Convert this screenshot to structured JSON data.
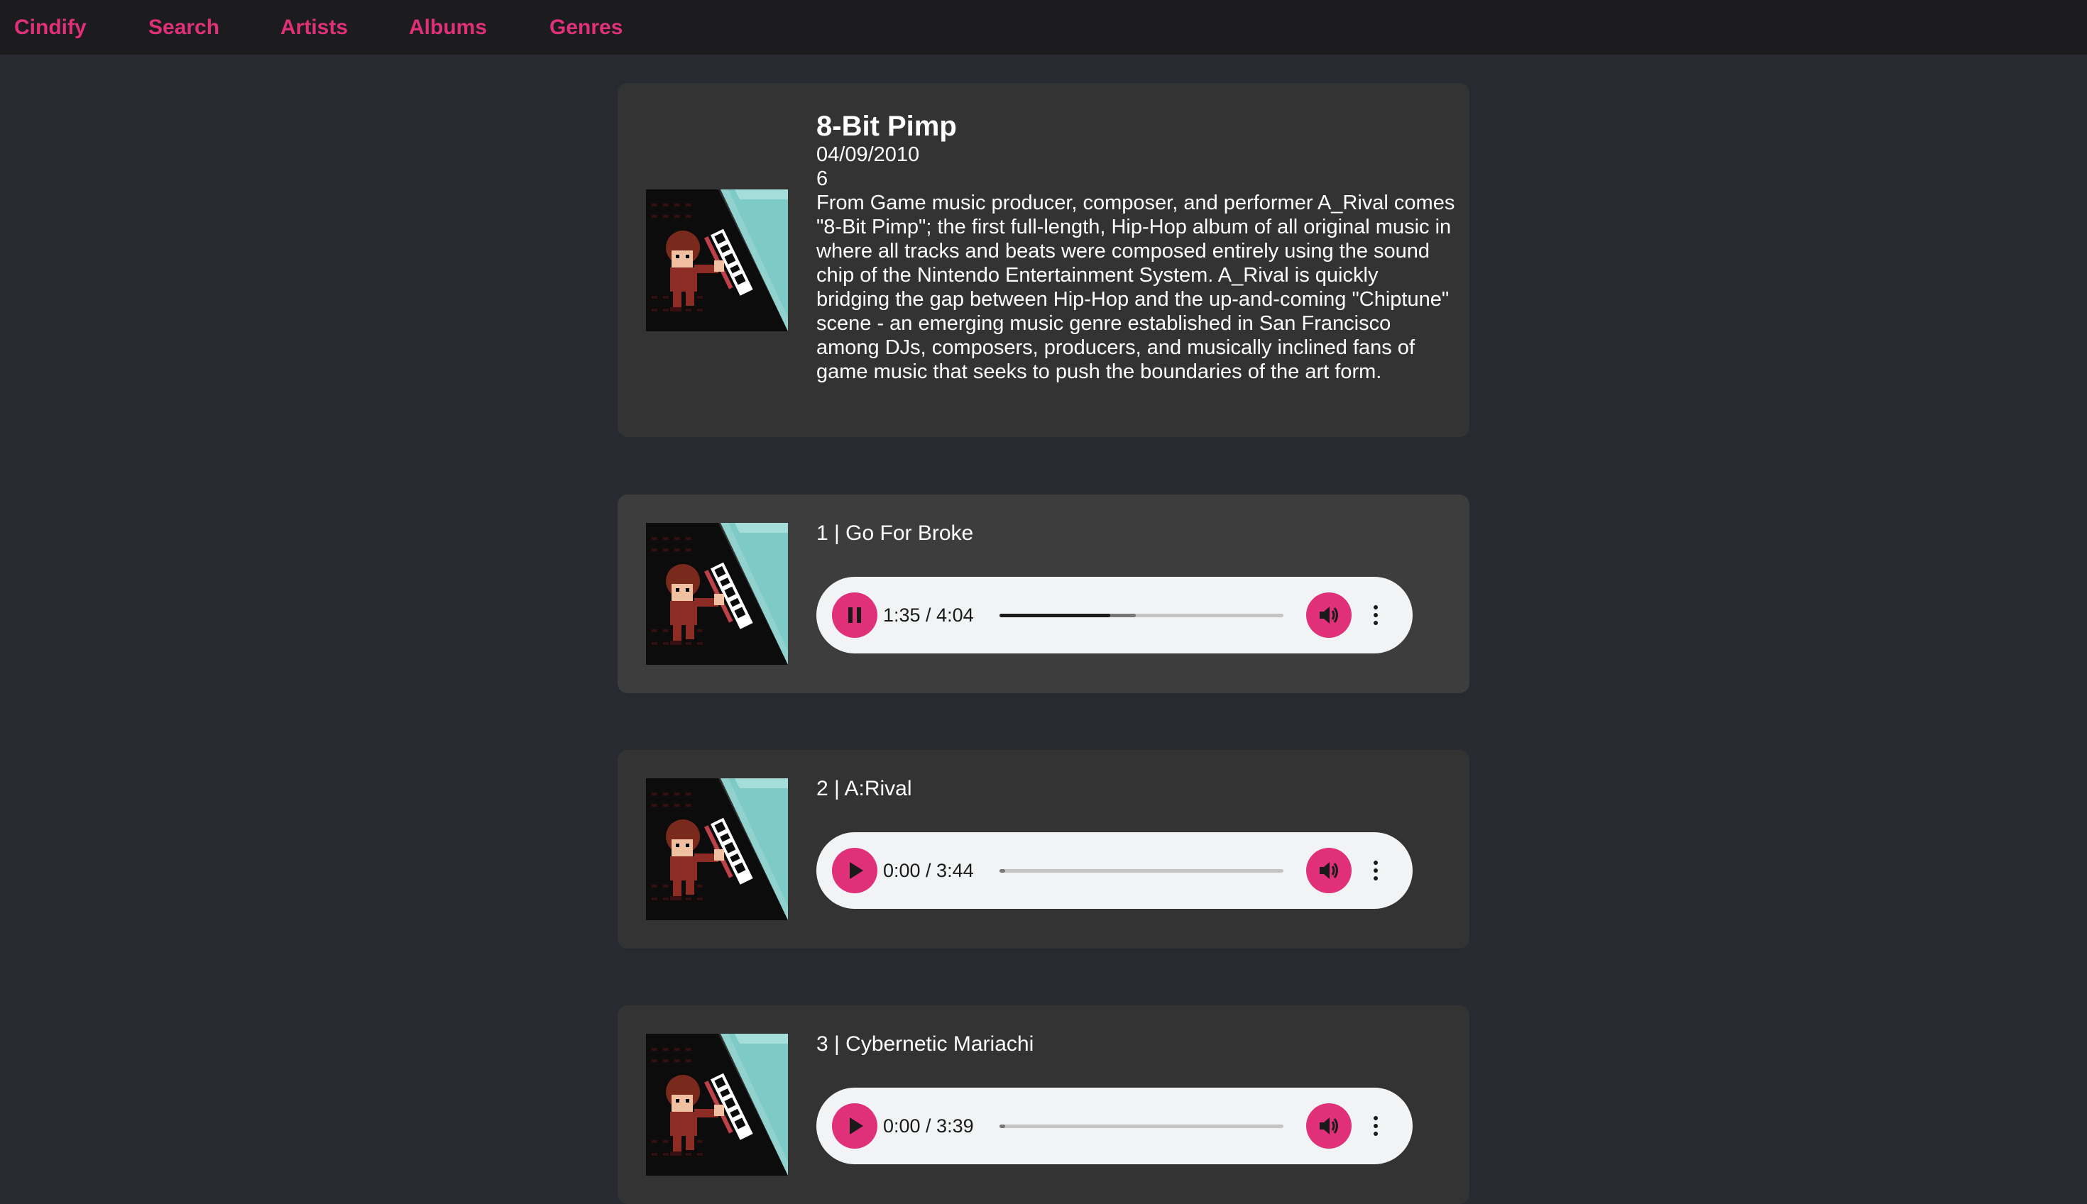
{
  "nav": {
    "brand": "Cindify",
    "items": [
      "Search",
      "Artists",
      "Albums",
      "Genres"
    ]
  },
  "album": {
    "title": "8-Bit Pimp",
    "date": "04/09/2010",
    "track_count": "6",
    "description": "From Game music producer, composer, and performer A_Rival comes \"8-Bit Pimp\"; the first full-length, Hip-Hop album of all original music in where all tracks and beats were composed entirely using the sound chip of the Nintendo Entertainment System. A_Rival is quickly bridging the gap between Hip-Hop and the up-and-coming \"Chiptune\" scene - an emerging music genre established in San Francisco among DJs, composers, producers, and musically inclined fans of game music that seeks to push the boundaries of the art form."
  },
  "tracks": [
    {
      "title": "1 | Go For Broke",
      "time": "1:35 / 4:04",
      "state": "playing",
      "progress": 0.39,
      "buffered": 0.48
    },
    {
      "title": "2 | A:Rival",
      "time": "0:00 / 3:44",
      "state": "paused",
      "progress": 0.0,
      "buffered": 0.02
    },
    {
      "title": "3 | Cybernetic Mariachi",
      "time": "0:00 / 3:39",
      "state": "paused",
      "progress": 0.0,
      "buffered": 0.02
    }
  ],
  "colors": {
    "accent": "#e0307a",
    "background": "#272a31",
    "nav_background": "#1c1c1e",
    "album_card": "#333333",
    "track_card_active": "#3d3d3d",
    "track_card": "#333333",
    "player_background": "#f1f3f4"
  },
  "icons": {
    "play": "play-icon",
    "pause": "pause-icon",
    "volume": "volume-icon",
    "more": "more-vertical-icon"
  }
}
